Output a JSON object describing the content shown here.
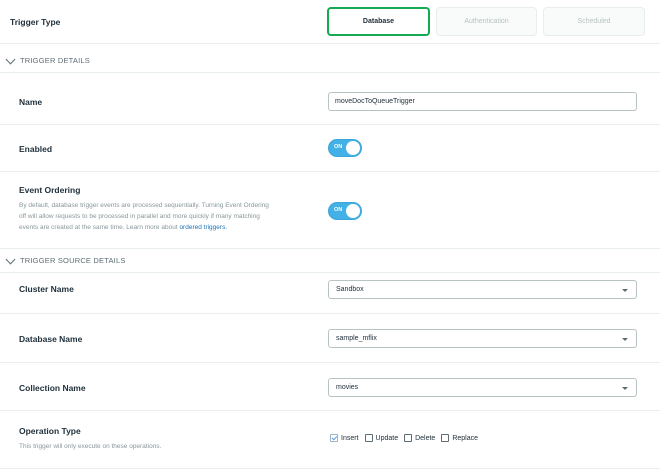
{
  "trigger_type": {
    "label": "Trigger Type",
    "options": [
      "Database",
      "Authentication",
      "Scheduled"
    ],
    "selected": "Database"
  },
  "trigger_details": {
    "section_title": "TRIGGER DETAILS",
    "name_label": "Name",
    "name_value": "moveDocToQueueTrigger",
    "enabled_label": "Enabled",
    "enabled_state": "ON",
    "event_ordering_label": "Event Ordering",
    "event_ordering_desc": "By default, database trigger events are processed sequentially. Turning Event Ordering off will allow requests to be processed in parallel and more quickly if many matching events are created at the same time. Learn more about",
    "event_ordering_link": "ordered triggers",
    "event_ordering_state": "ON"
  },
  "source_details": {
    "section_title": "TRIGGER SOURCE DETAILS",
    "cluster_label": "Cluster Name",
    "cluster_value": "Sandbox",
    "database_label": "Database Name",
    "database_value": "sample_mflix",
    "collection_label": "Collection Name",
    "collection_value": "movies",
    "operation_label": "Operation Type",
    "operation_desc": "This trigger will only execute on these operations.",
    "operations": [
      {
        "label": "Insert",
        "checked": true
      },
      {
        "label": "Update",
        "checked": false
      },
      {
        "label": "Delete",
        "checked": false
      },
      {
        "label": "Replace",
        "checked": false
      }
    ]
  },
  "colors": {
    "accent_green": "#13aa52",
    "toggle_blue": "#43b1e5",
    "link_blue": "#1a73b8"
  }
}
